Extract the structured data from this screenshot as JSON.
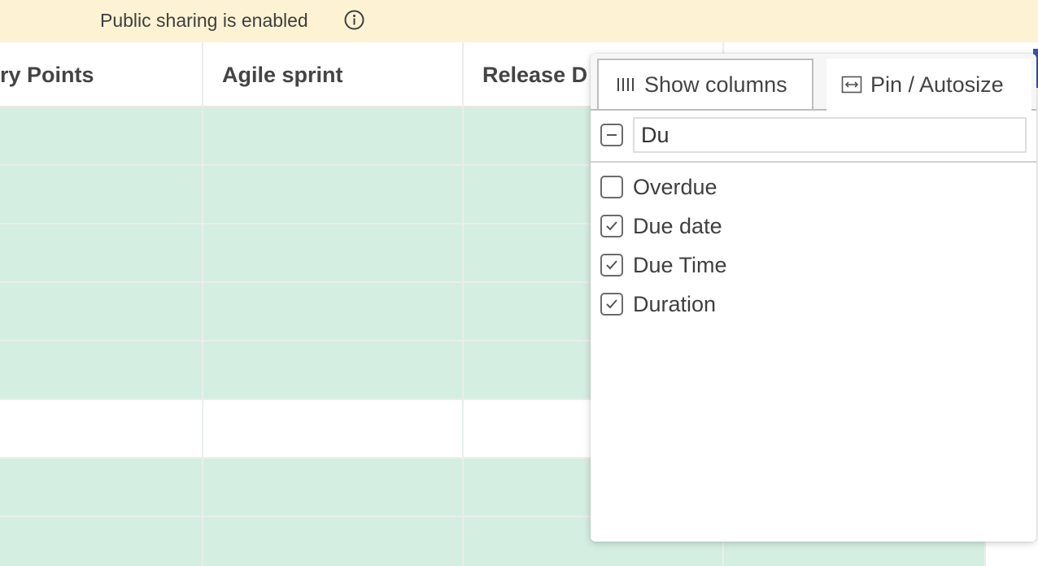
{
  "banner": {
    "text": "Public sharing is enabled",
    "icon": "info-icon",
    "background": "#fdf3d4"
  },
  "grid": {
    "columns": [
      "ry Points",
      "Agile sprint",
      "Release D"
    ],
    "row_colors": [
      "green",
      "green",
      "green",
      "green",
      "green",
      "white",
      "green",
      "green"
    ],
    "green_color": "#d5eee2"
  },
  "popup": {
    "tabs": [
      {
        "label": "Show columns",
        "icon": "columns-icon",
        "active": true
      },
      {
        "label": "Pin / Autosize",
        "icon": "resize-horizontal-icon",
        "active": false
      }
    ],
    "filter": {
      "value": "Du",
      "placeholder": ""
    },
    "columns": [
      {
        "label": "Overdue",
        "checked": false
      },
      {
        "label": "Due date",
        "checked": true
      },
      {
        "label": "Due Time",
        "checked": true
      },
      {
        "label": "Duration",
        "checked": true
      }
    ]
  }
}
